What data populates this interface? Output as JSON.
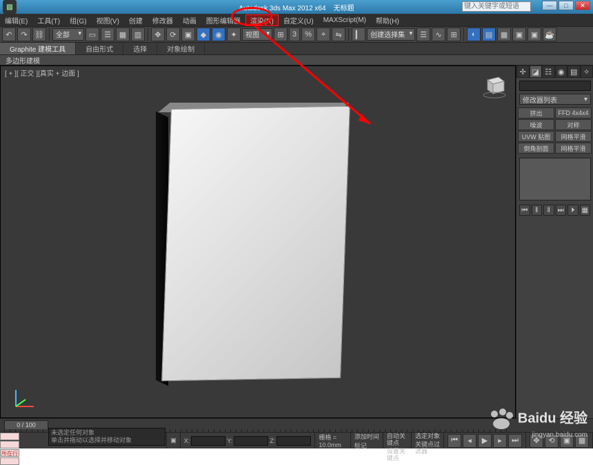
{
  "titlebar": {
    "app": "Autodesk 3ds Max 2012 x64",
    "doc": "无标题",
    "search_placeholder": "键入关键字或短语"
  },
  "window_buttons": {
    "min": "—",
    "max": "□",
    "close": "✕"
  },
  "menus": [
    "编辑(E)",
    "工具(T)",
    "组(G)",
    "视图(V)",
    "创建",
    "修改器",
    "动画",
    "图形编辑器",
    "渲染(R)",
    "自定义(U)",
    "MAXScript(M)",
    "帮助(H)"
  ],
  "toolbar": {
    "scope": "全部",
    "view": "视图",
    "angle": "3",
    "selection_set": "创建选择集"
  },
  "ribbon": {
    "tabs": [
      "Graphite 建模工具",
      "自由形式",
      "选择",
      "对象绘制"
    ],
    "sub": "多边形建模"
  },
  "viewport": {
    "label": "[ + ][ 正交 ][真实 + 边面 ]"
  },
  "right_panel": {
    "modifier_list": "修改器列表",
    "buttons": [
      "挤出",
      "FFD 4x4x4",
      "噪波",
      "对称",
      "UVW 贴图",
      "网格平滑",
      "倒角剖面",
      "网格平滑"
    ],
    "playback": [
      "⏮",
      "‖",
      "‖",
      "⏭",
      "⏵",
      "▦"
    ]
  },
  "timeline": {
    "pos": "0 / 100"
  },
  "status": {
    "prompt1": "未选定任何对象",
    "prompt2": "单击并拖动以选择并移动对象",
    "coord_x": "X:",
    "coord_y": "Y:",
    "coord_z": "Z:",
    "grid": "栅格 = 10.0mm",
    "autokey": "自动关键点",
    "selobj": "选定对象",
    "setkey": "设置关键点",
    "keyfilter": "关键点过滤器",
    "add_time": "添加时间标记",
    "left_btn": "所在行"
  },
  "watermark": {
    "brand": "Baidu 经验",
    "url": "jingyan.baidu.com"
  }
}
